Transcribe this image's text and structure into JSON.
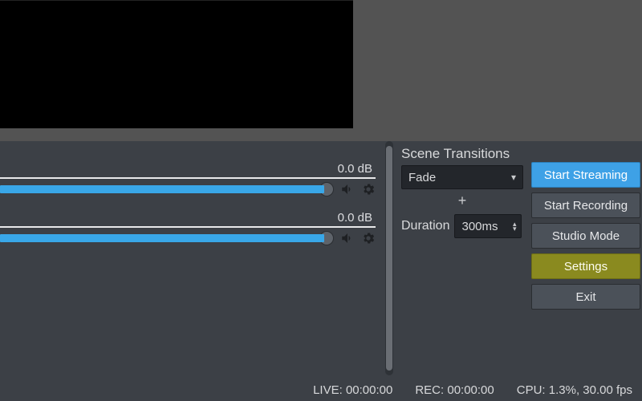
{
  "mixer": {
    "channels": [
      {
        "db": "0.0 dB"
      },
      {
        "db": "0.0 dB"
      }
    ]
  },
  "transitions": {
    "title": "Scene Transitions",
    "selected": "Fade",
    "plus": "+",
    "duration_label": "Duration",
    "duration_value": "300ms"
  },
  "controls": {
    "start_streaming": "Start Streaming",
    "start_recording": "Start Recording",
    "studio_mode": "Studio Mode",
    "settings": "Settings",
    "exit": "Exit"
  },
  "statusbar": {
    "live": "LIVE: 00:00:00",
    "rec": "REC: 00:00:00",
    "cpu": "CPU: 1.3%, 30.00 fps"
  }
}
